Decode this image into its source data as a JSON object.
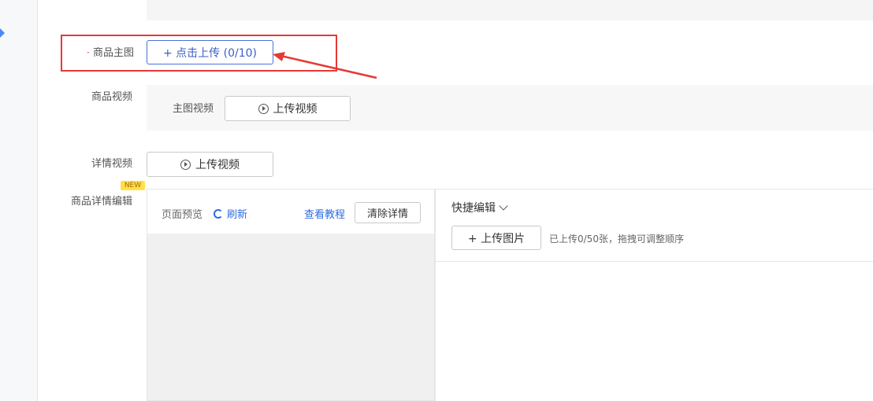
{
  "main_image": {
    "label": "商品主图",
    "upload_button": "+ 点击上传 (0/10)"
  },
  "product_video": {
    "label": "商品视频",
    "sub_label": "主图视频",
    "upload_button": "上传视频"
  },
  "detail_video": {
    "label": "详情视频",
    "upload_button": "上传视频"
  },
  "detail_editor": {
    "label": "商品详情编辑",
    "new_badge": "NEW",
    "preview_label": "页面预览",
    "refresh_link": "刷新",
    "tutorial_link": "查看教程",
    "clear_button": "清除详情",
    "quick_edit_label": "快捷编辑",
    "upload_image_button": "+ 上传图片",
    "upload_hint": "已上传0/50张，拖拽可调整顺序"
  },
  "colors": {
    "highlight": "#e53935",
    "primary": "#2f6be0"
  }
}
